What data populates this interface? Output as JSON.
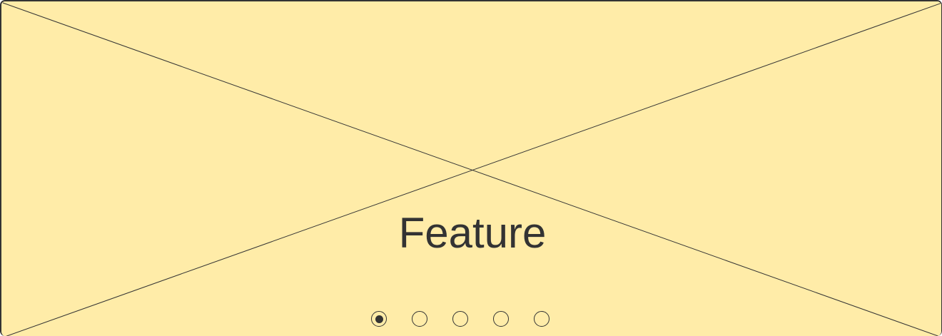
{
  "carousel": {
    "title": "Feature",
    "background_color": "#ffeca8",
    "line_color": "#333333",
    "slide_count": 5,
    "active_index": 0
  }
}
